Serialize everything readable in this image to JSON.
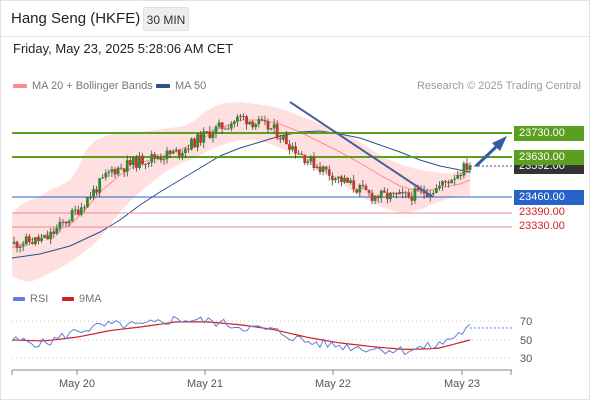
{
  "header": {
    "symbol": "Hang Seng (HKFE)",
    "timeframe": "30 MIN"
  },
  "datetime": "Friday, May 23, 2025 5:28:06 AM CET",
  "legend": {
    "bb_label": "MA 20 + Bollinger Bands",
    "ma50_label": "MA 50",
    "copyright": "Research © 2025 Trading Central"
  },
  "colors": {
    "resistance": "#5aa01e",
    "pivot": "#2563c9",
    "support": "#d02424",
    "bollinger": "#ff9e9e",
    "ma50": "#2b4f8f",
    "trendline": "#4b5f9b",
    "arrow": "#2f5fa0",
    "rsi": "#5b82d6",
    "rsi_ma": "#d02020"
  },
  "levels": {
    "resistance": [
      "23730.00",
      "23630.00"
    ],
    "current": "23592.00",
    "pivot": "23460.00",
    "support": [
      "23390.00",
      "23330.00"
    ]
  },
  "rsi_legend": {
    "rsi_label": "RSI",
    "ma_label": "9MA"
  },
  "x_axis_labels": [
    "May 20",
    "May 21",
    "May 22",
    "May 23"
  ],
  "chart_data": [
    {
      "type": "line",
      "title": "",
      "subtitle": "",
      "y_scale": "price",
      "yrange": [
        23120,
        23900
      ],
      "horizontal_levels": [
        {
          "value": 23730,
          "role": "resistance"
        },
        {
          "value": 23630,
          "role": "resistance"
        },
        {
          "value": 23460,
          "role": "pivot"
        },
        {
          "value": 23390,
          "role": "support"
        },
        {
          "value": 23330,
          "role": "support"
        }
      ],
      "current_price": 23592,
      "x": [
        "May 20",
        "May 21",
        "May 22",
        "May 23"
      ],
      "series": [
        {
          "name": "MA 20 + Bollinger Bands",
          "values": [
            23285,
            23545,
            23655,
            23495,
            23550
          ]
        },
        {
          "name": "MA 50",
          "values": [
            23165,
            23400,
            23700,
            23520,
            23590
          ]
        }
      ],
      "price_path": [
        23230,
        23250,
        23390,
        23560,
        23610,
        23640,
        23730,
        23800,
        23740,
        23610,
        23520,
        23445,
        23440,
        23480,
        23590
      ]
    },
    {
      "type": "line",
      "title": "",
      "subtitle": "",
      "yticks": [
        30,
        50,
        70
      ],
      "yrange": [
        15,
        85
      ],
      "series": [
        {
          "name": "RSI",
          "values": [
            50,
            46,
            60,
            66,
            65,
            72,
            70,
            64,
            60,
            48,
            44,
            41,
            39,
            44,
            63
          ]
        },
        {
          "name": "9MA",
          "values": [
            50,
            49,
            53,
            60,
            64,
            69,
            69,
            66,
            61,
            53,
            47,
            43,
            40,
            41,
            50
          ]
        }
      ]
    }
  ]
}
